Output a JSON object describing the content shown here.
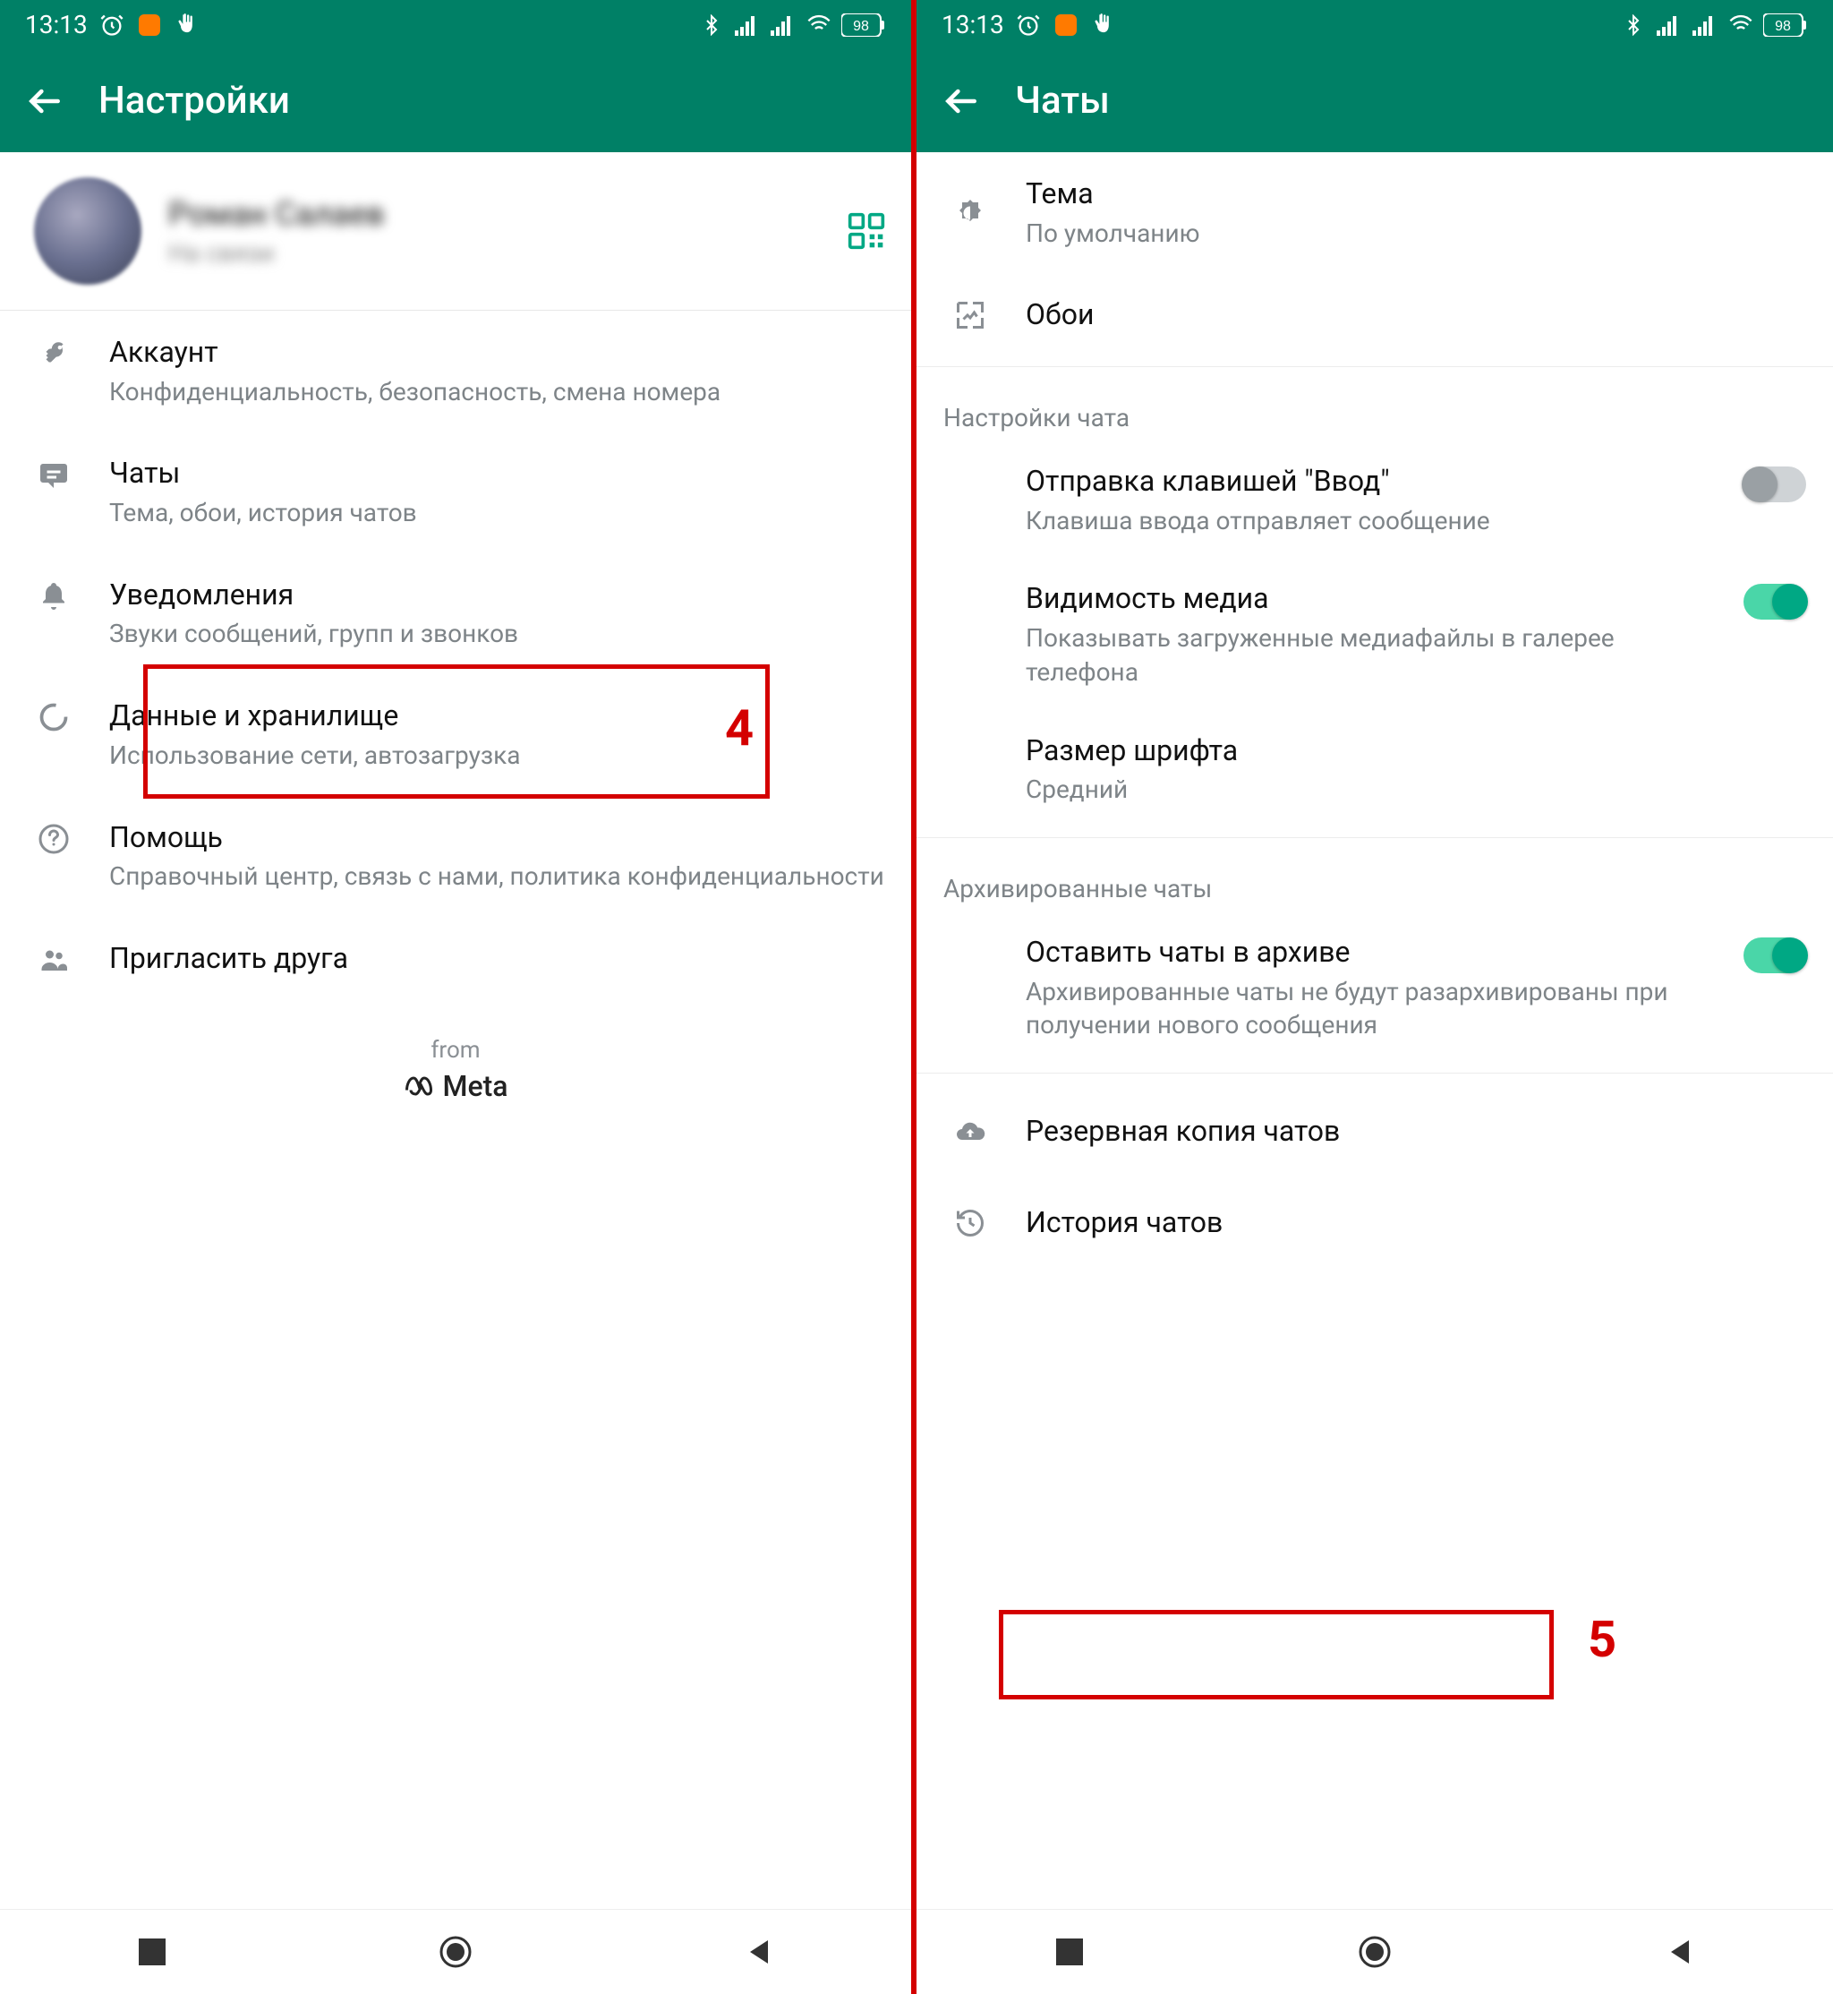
{
  "status": {
    "time": "13:13",
    "battery": "98"
  },
  "left": {
    "title": "Настройки",
    "profile": {
      "name": "Роман Салаев",
      "status": "На связи"
    },
    "items": {
      "account": {
        "title": "Аккаунт",
        "sub": "Конфиденциальность, безопасность, смена номера"
      },
      "chats": {
        "title": "Чаты",
        "sub": "Тема, обои, история чатов"
      },
      "notif": {
        "title": "Уведомления",
        "sub": "Звуки сообщений, групп и звонков"
      },
      "data": {
        "title": "Данные и хранилище",
        "sub": "Использование сети, автозагрузка"
      },
      "help": {
        "title": "Помощь",
        "sub": "Справочный центр, связь с нами, политика конфиденциальности"
      },
      "invite": {
        "title": "Пригласить друга"
      }
    },
    "from": "from",
    "meta": "Meta"
  },
  "right": {
    "title": "Чаты",
    "theme": {
      "title": "Тема",
      "sub": "По умолчанию"
    },
    "wallpaper": {
      "title": "Обои"
    },
    "section_chat": "Настройки чата",
    "enter": {
      "title": "Отправка клавишей \"Ввод\"",
      "sub": "Клавиша ввода отправляет сообщение"
    },
    "media": {
      "title": "Видимость медиа",
      "sub": "Показывать загруженные медиафайлы в галерее телефона"
    },
    "font": {
      "title": "Размер шрифта",
      "sub": "Средний"
    },
    "section_arch": "Архивированные чаты",
    "archive": {
      "title": "Оставить чаты в архиве",
      "sub": "Архивированные чаты не будут разархивированы при получении нового сообщения"
    },
    "backup": {
      "title": "Резервная копия чатов"
    },
    "history": {
      "title": "История чатов"
    }
  },
  "annotations": {
    "four": "4",
    "five": "5"
  }
}
